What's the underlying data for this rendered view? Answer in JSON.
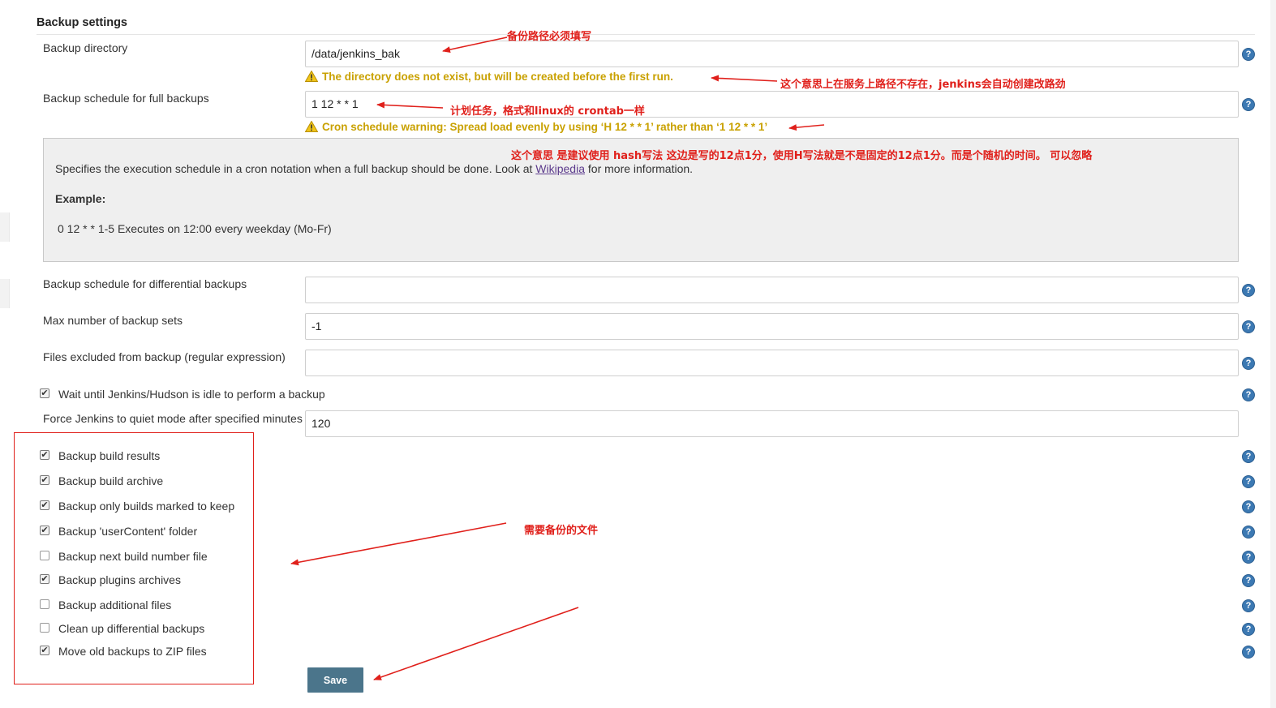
{
  "section": {
    "title": "Backup settings"
  },
  "fields": {
    "backup_directory": {
      "label": "Backup directory",
      "value": "/data/jenkins_bak"
    },
    "directory_warning": "The directory does not exist, but will be created before the first run.",
    "full_schedule": {
      "label": "Backup schedule for full backups",
      "value": "1 12 * * 1"
    },
    "cron_warning": "Cron schedule warning: Spread load evenly by using ‘H 12 * * 1’ rather than ‘1 12 * * 1’",
    "diff_schedule": {
      "label": "Backup schedule for differential backups",
      "value": ""
    },
    "max_sets": {
      "label": "Max number of backup sets",
      "value": "-1"
    },
    "excluded": {
      "label": "Files excluded from backup (regular expression)",
      "value": ""
    },
    "wait_idle": {
      "label": "Wait until Jenkins/Hudson is idle to perform a backup",
      "checked": true
    },
    "quiet_mode": {
      "label": "Force Jenkins to quiet mode after specified minutes",
      "value": "120"
    }
  },
  "help_panel": {
    "text_before": "Specifies the execution schedule in a cron notation when a full backup should be done. Look at ",
    "link": "Wikipedia",
    "text_after": " for more information.",
    "example_title": "Example:",
    "example": "0 12 * * 1-5 Executes on 12:00 every weekday (Mo-Fr)"
  },
  "options": [
    {
      "label": "Backup build results",
      "checked": true
    },
    {
      "label": "Backup build archive",
      "checked": true
    },
    {
      "label": "Backup only builds marked to keep",
      "checked": true
    },
    {
      "label": "Backup 'userContent' folder",
      "checked": true
    },
    {
      "label": "Backup next build number file",
      "checked": false
    },
    {
      "label": "Backup plugins archives",
      "checked": true
    },
    {
      "label": "Backup additional files",
      "checked": false
    },
    {
      "label": "Clean up differential backups",
      "checked": false
    },
    {
      "label": "Move old backups to ZIP files",
      "checked": true
    }
  ],
  "save_label": "Save",
  "help_glyph": "?",
  "check_glyph": "✔",
  "annotations": {
    "dir_required": "备份路径必须填写",
    "dir_auto_create": "这个意思上在服务上路径不存在，jenkins会自动创建改路劲",
    "cron_task": "计划任务，格式和linux的 crontab一样",
    "hash_advice": "这个意思 是建议使用 hash写法    这边是写的12点1分，使用H写法就是不是固定的12点1分。而是个随机的时间。 可以忽略",
    "files_to_backup": "需要备份的文件"
  },
  "colors": {
    "annotation_red": "#e0201b",
    "warning_yellow": "#c9a100",
    "help_blue": "#3c79b3",
    "save_button": "#4b758b"
  }
}
